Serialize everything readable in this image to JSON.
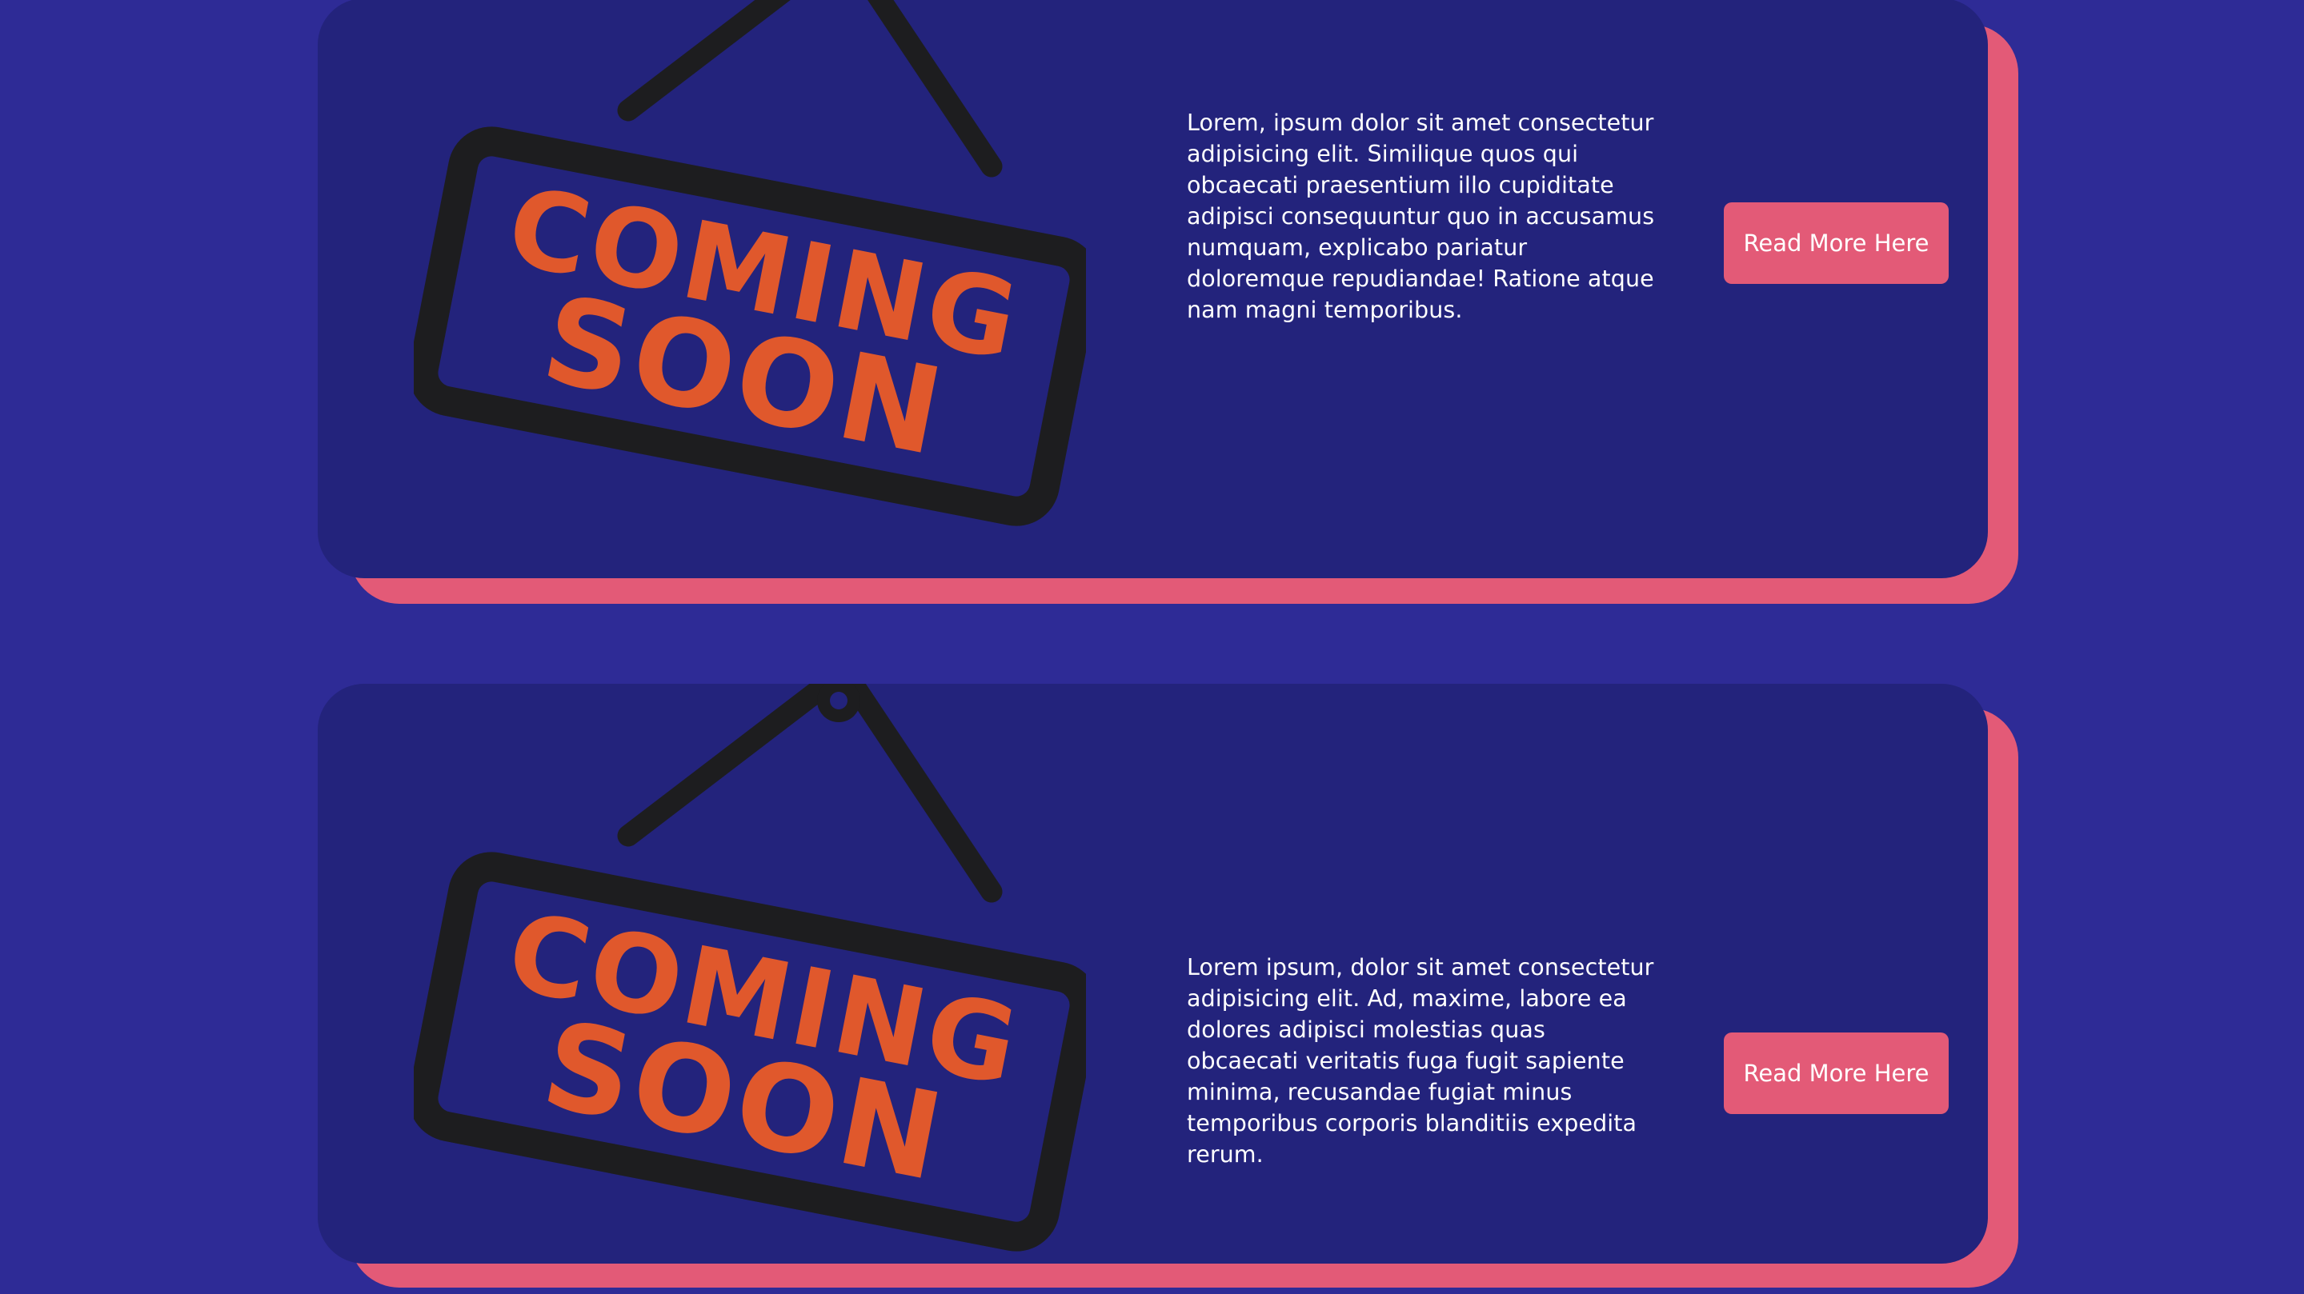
{
  "colors": {
    "page_background": "#2e2b96",
    "card_background": "#23237c",
    "accent_shadow": "#e35a77",
    "button_background": "#e35a77",
    "button_text": "#ffffff",
    "sign_frame": "#1d1d1f",
    "sign_text": "#e0582c"
  },
  "cards": [
    {
      "image": {
        "icon": "coming-soon-sign-icon",
        "line1": "COMING",
        "line2": "SOON"
      },
      "description": "Lorem, ipsum dolor sit amet consectetur adipisicing elit. Similique quos qui obcaecati praesentium illo cupiditate adipisci consequuntur quo in accusamus numquam, explicabo pariatur doloremque repudiandae! Ratione atque nam magni temporibus.",
      "button_label": "Read More Here"
    },
    {
      "image": {
        "icon": "coming-soon-sign-icon",
        "line1": "COMING",
        "line2": "SOON"
      },
      "description": "Lorem ipsum, dolor sit amet consectetur adipisicing elit. Ad, maxime, labore ea dolores adipisci molestias quas obcaecati veritatis fuga fugit sapiente minima, recusandae fugiat minus temporibus corporis blanditiis expedita rerum.",
      "button_label": "Read More Here"
    }
  ]
}
